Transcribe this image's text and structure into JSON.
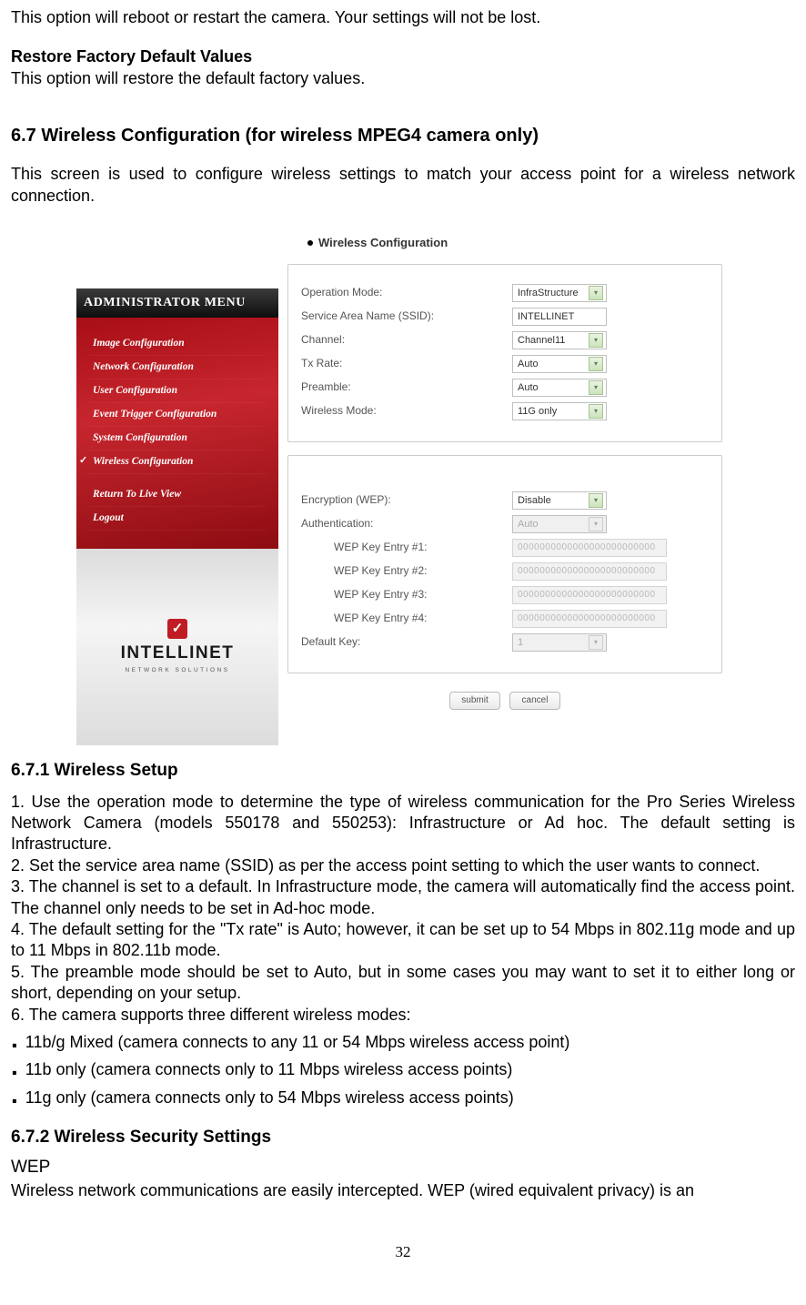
{
  "intro": {
    "p1": "This option will reboot or restart the camera. Your settings will not be lost.",
    "p2_title": "Restore Factory Default Values",
    "p2_body": "This option will restore the default factory values."
  },
  "section67": {
    "heading": "6.7 Wireless Configuration (for wireless MPEG4 camera only)",
    "desc": "This screen is used to configure wireless settings to match your access point for a wireless network connection."
  },
  "screenshot": {
    "sidebar": {
      "admin_title": "ADMINISTRATOR MENU",
      "items": {
        "image": "Image Configuration",
        "network": "Network Configuration",
        "user": "User Configuration",
        "event": "Event Trigger Configuration",
        "system": "System Configuration",
        "wireless": "Wireless Configuration",
        "return": "Return To Live View",
        "logout": "Logout"
      },
      "logo_text": "INTELLINET",
      "logo_sub": "NETWORK SOLUTIONS"
    },
    "main": {
      "title": "Wireless Configuration",
      "box1": {
        "op_mode_label": "Operation Mode:",
        "op_mode_value": "InfraStructure",
        "ssid_label": "Service Area Name (SSID):",
        "ssid_value": "INTELLINET",
        "channel_label": "Channel:",
        "channel_value": "Channel11",
        "txrate_label": "Tx Rate:",
        "txrate_value": "Auto",
        "preamble_label": "Preamble:",
        "preamble_value": "Auto",
        "wmode_label": "Wireless Mode:",
        "wmode_value": "11G only"
      },
      "box2": {
        "enc_label": "Encryption (WEP):",
        "enc_value": "Disable",
        "auth_label": "Authentication:",
        "auth_value": "Auto",
        "key1_label": "WEP Key Entry #1:",
        "key2_label": "WEP Key Entry #2:",
        "key3_label": "WEP Key Entry #3:",
        "key4_label": "WEP Key Entry #4:",
        "key_placeholder": "0000000000000000000000000",
        "default_label": "Default Key:",
        "default_value": "1"
      },
      "buttons": {
        "submit": "submit",
        "cancel": "cancel"
      }
    }
  },
  "section671": {
    "heading": "6.7.1 Wireless Setup",
    "p1": "1. Use the operation mode to determine the type of wireless communication for the Pro Series Wireless Network Camera (models 550178 and 550253): Infrastructure or Ad hoc. The default setting is Infrastructure.",
    "p2": "2. Set the service area name (SSID) as per the access point setting to which the user wants to connect.",
    "p3": "3. The channel is set to a default. In Infrastructure mode, the camera will automatically find the access point. The channel only needs to be set in Ad-hoc mode.",
    "p4": "4. The default setting for the \"Tx rate\" is Auto; however, it can be set up to 54 Mbps in 802.11g mode and up to 11 Mbps in 802.11b mode.",
    "p5": "5. The preamble mode should be set to Auto, but in some cases you may want to set it to either long or short, depending on your setup.",
    "p6": "6. The camera supports three different wireless modes:",
    "b1": "11b/g Mixed (camera connects to any 11 or 54 Mbps wireless access point)",
    "b2": "11b only (camera connects only to 11 Mbps wireless access points)",
    "b3": "11g only (camera connects only to 54 Mbps wireless access points)"
  },
  "section672": {
    "heading": "6.7.2 Wireless Security Settings",
    "wep_title": "WEP",
    "wep_body": "Wireless network communications are easily intercepted. WEP (wired equivalent privacy) is an"
  },
  "page_number": "32"
}
